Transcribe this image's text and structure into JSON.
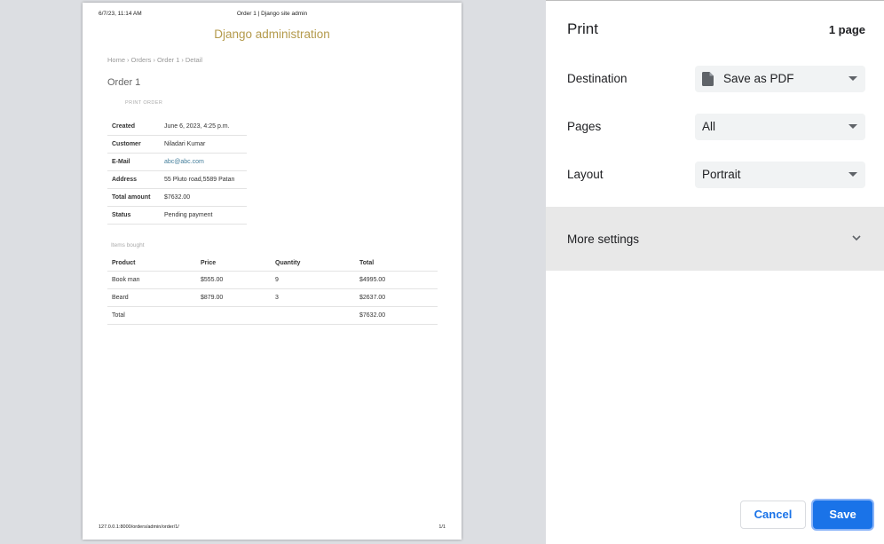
{
  "preview": {
    "header_date": "6/7/23, 11:14 AM",
    "header_title": "Order 1 | Django site admin",
    "site_title": "Django administration",
    "breadcrumbs": [
      "Home",
      "Orders",
      "Order 1",
      "Detail"
    ],
    "page_heading": "Order 1",
    "print_order_link": "PRINT ORDER",
    "order_info": [
      {
        "key": "Created",
        "value": "June 6, 2023, 4:25 p.m."
      },
      {
        "key": "Customer",
        "value": "Niladari Kumar"
      },
      {
        "key": "E-Mail",
        "value": "abc@abc.com"
      },
      {
        "key": "Address",
        "value": "55 Pluto road,5589 Patan"
      },
      {
        "key": "Total amount",
        "value": "$7632.00"
      },
      {
        "key": "Status",
        "value": "Pending payment"
      }
    ],
    "items_caption": "Items bought",
    "items_columns": [
      "Product",
      "Price",
      "Quantity",
      "Total"
    ],
    "items_rows": [
      [
        "Book man",
        "$555.00",
        "9",
        "$4995.00"
      ],
      [
        "Beard",
        "$879.00",
        "3",
        "$2637.00"
      ]
    ],
    "total_label": "Total",
    "total_value": "$7632.00",
    "footer_url": "127.0.0.1:8000/orders/admin/order/1/",
    "footer_page": "1/1"
  },
  "panel": {
    "title": "Print",
    "page_count": "1 page",
    "destination_label": "Destination",
    "destination_value": "Save as PDF",
    "destination_icon": "document-icon",
    "pages_label": "Pages",
    "pages_value": "All",
    "layout_label": "Layout",
    "layout_value": "Portrait",
    "more_settings": "More settings",
    "cancel": "Cancel",
    "save": "Save"
  },
  "colors": {
    "accent": "#1a73e8",
    "site_title": "#b49a4c",
    "link": "#447e9b"
  }
}
